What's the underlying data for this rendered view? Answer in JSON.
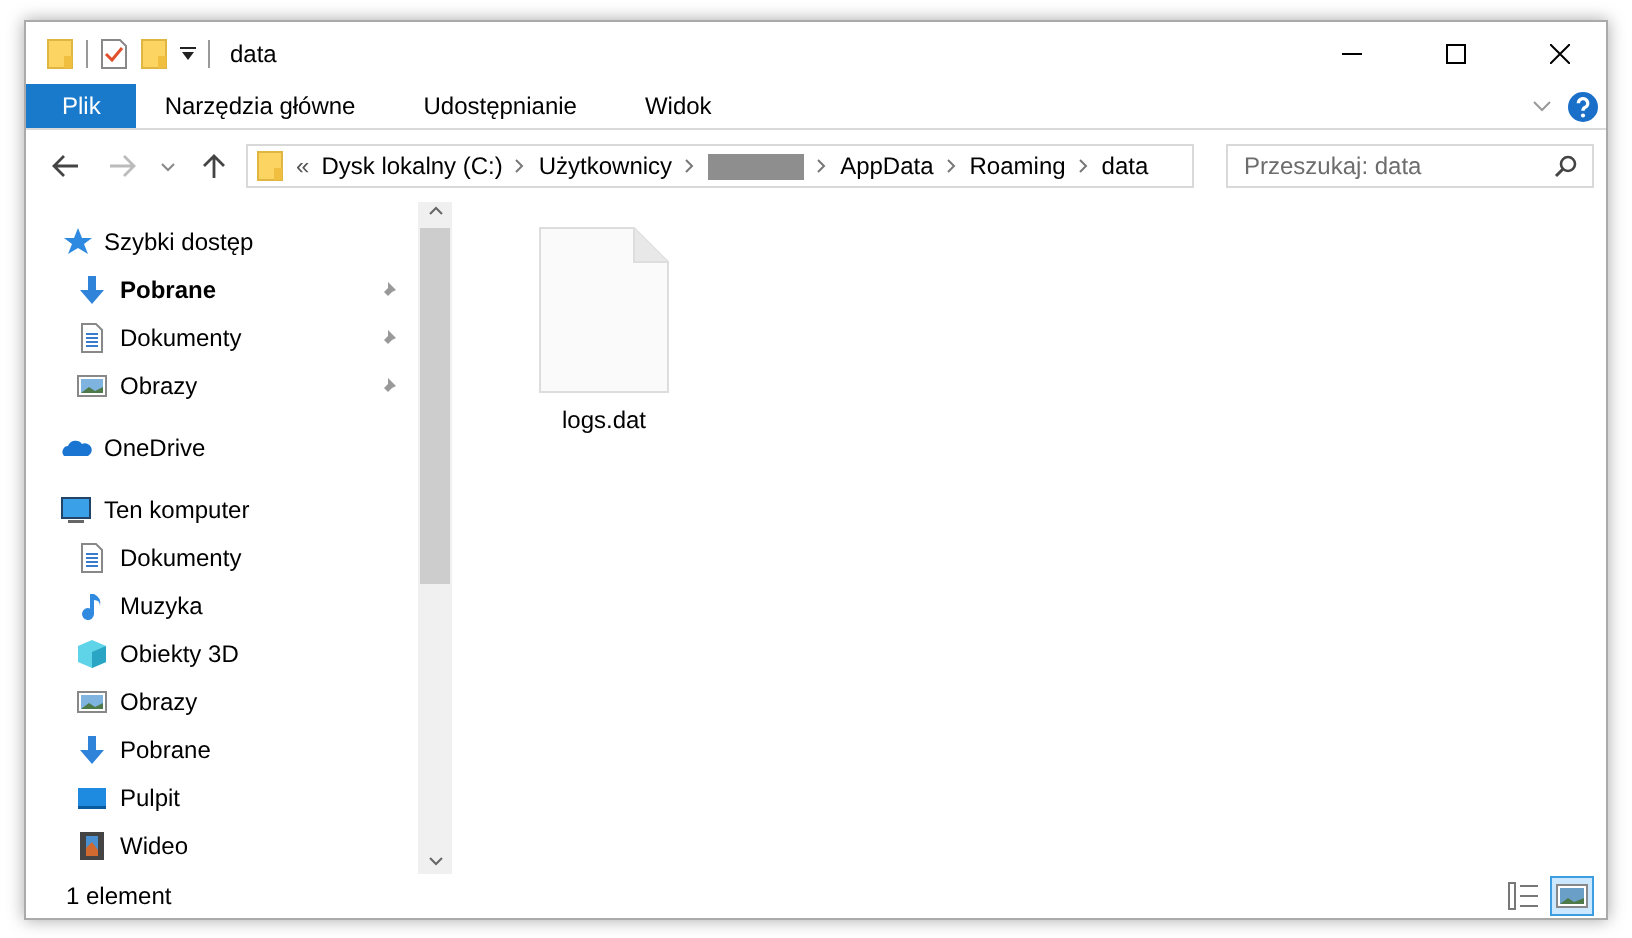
{
  "window": {
    "title": "data"
  },
  "ribbon": {
    "tabs": [
      {
        "label": "Plik",
        "kind": "file"
      },
      {
        "label": "Narzędzia główne",
        "kind": "tab"
      },
      {
        "label": "Udostępnianie",
        "kind": "tab"
      },
      {
        "label": "Widok",
        "kind": "tab"
      }
    ]
  },
  "address": {
    "overflow": "«",
    "segments": [
      {
        "kind": "text",
        "label": "Dysk lokalny (C:)"
      },
      {
        "kind": "text",
        "label": "Użytkownicy"
      },
      {
        "kind": "redacted"
      },
      {
        "kind": "text",
        "label": "AppData"
      },
      {
        "kind": "text",
        "label": "Roaming"
      },
      {
        "kind": "text",
        "label": "data"
      }
    ]
  },
  "search": {
    "placeholder": "Przeszukaj: data"
  },
  "sidebar": {
    "items": [
      {
        "label": "Szybki dostęp",
        "kind": "star",
        "children": [
          {
            "label": "Pobrane",
            "kind": "download",
            "pinned": true,
            "emphasized": true
          },
          {
            "label": "Dokumenty",
            "kind": "document",
            "pinned": true,
            "emphasized": false
          },
          {
            "label": "Obrazy",
            "kind": "image",
            "pinned": true,
            "emphasized": false
          }
        ]
      },
      {
        "label": "OneDrive",
        "kind": "cloud"
      },
      {
        "label": "Ten komputer",
        "kind": "computer",
        "children": [
          {
            "label": "Dokumenty",
            "kind": "document",
            "pinned": false,
            "emphasized": false
          },
          {
            "label": "Muzyka",
            "kind": "music",
            "pinned": false,
            "emphasized": false
          },
          {
            "label": "Obiekty 3D",
            "kind": "cube",
            "pinned": false,
            "emphasized": false
          },
          {
            "label": "Obrazy",
            "kind": "image",
            "pinned": false,
            "emphasized": false
          },
          {
            "label": "Pobrane",
            "kind": "download",
            "pinned": false,
            "emphasized": false
          },
          {
            "label": "Pulpit",
            "kind": "desktop",
            "pinned": false,
            "emphasized": false
          },
          {
            "label": "Wideo",
            "kind": "video",
            "pinned": false,
            "emphasized": false
          }
        ]
      }
    ]
  },
  "files": [
    {
      "name": "logs.dat",
      "selected": false
    }
  ],
  "status_bar": {
    "count": "1 element",
    "views": [
      {
        "kind": "details",
        "selected": false
      },
      {
        "kind": "large",
        "selected": true
      }
    ]
  }
}
